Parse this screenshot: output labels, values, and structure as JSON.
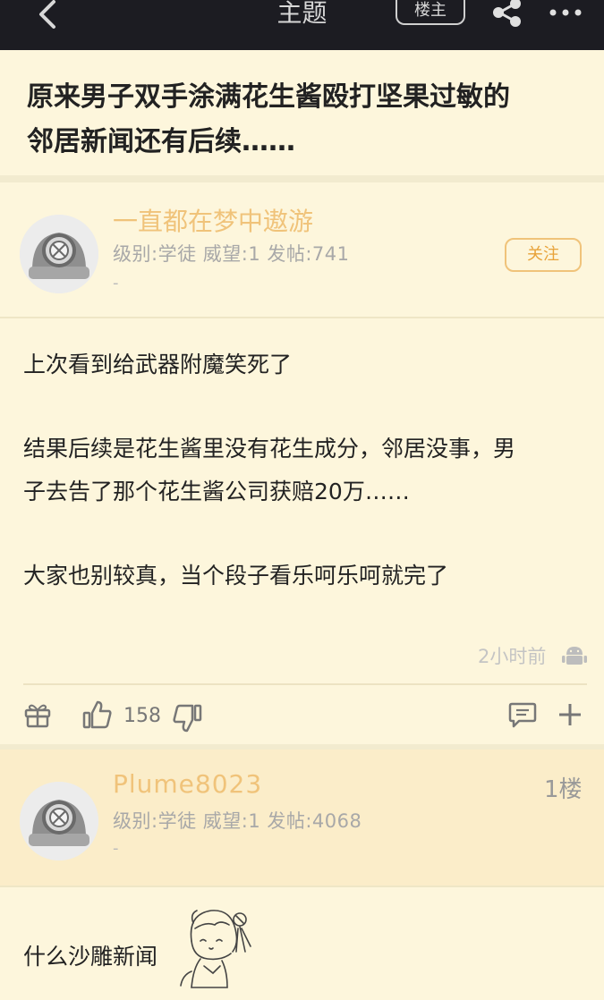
{
  "topbar": {
    "title": "主题",
    "owner_badge": "楼主",
    "back_icon": "chevron-left-icon",
    "share_icon": "share-icon",
    "more_icon": "more-icon"
  },
  "post": {
    "title_line1": "原来男子双手涂满花生酱殴打坚果过敏的",
    "title_line2": "邻居新闻还有后续……"
  },
  "author": {
    "name": "一直都在梦中遨游",
    "meta": "级别:学徒 威望:1 发帖:741",
    "signature": "-",
    "follow_label": "关注"
  },
  "content": {
    "p1": "上次看到给武器附魔笑死了",
    "p2_line1": "结果后续是花生酱里没有花生成分，邻居没事，男",
    "p2_line2": "子去告了那个花生酱公司获赔20万……",
    "p3": "大家也别较真，当个段子看乐呵乐呵就完了"
  },
  "footer": {
    "time": "2小时前",
    "like_count": "158"
  },
  "reply": {
    "name": "Plume8023",
    "floor": "1楼",
    "meta": "级别:学徒 威望:1 发帖:4068",
    "signature": "-",
    "text": "什么沙雕新闻"
  },
  "colors": {
    "background": "#fdf6dc",
    "topbar": "#1c1c22",
    "username": "#f0c37a",
    "reply_bg": "#fbedc9"
  }
}
